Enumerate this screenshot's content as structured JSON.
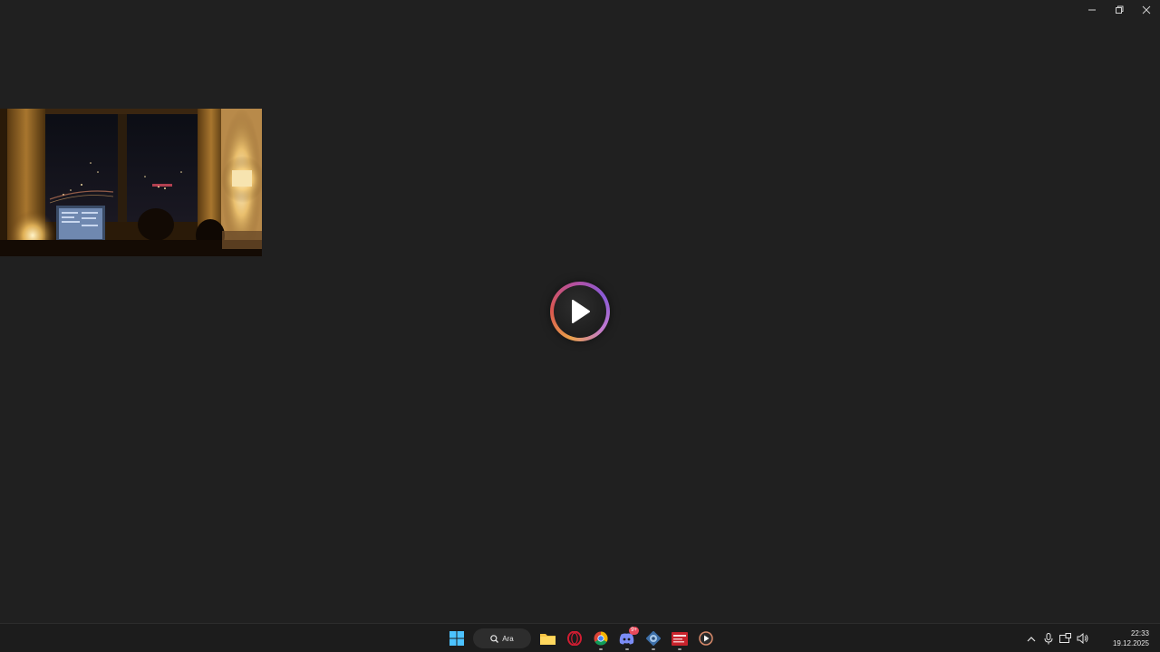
{
  "window": {
    "controls": [
      "minimize",
      "restore",
      "close"
    ]
  },
  "player": {
    "thumbnail_icon": "video-thumbnail",
    "play_icon": "play-icon",
    "accent_gradient": [
      "#e9a04a",
      "#d9574f",
      "#b8509b",
      "#8a5ad6"
    ]
  },
  "taskbar": {
    "search_label": "Ara",
    "apps": [
      {
        "name": "start",
        "icon": "windows-icon",
        "running": false
      },
      {
        "name": "file-explorer",
        "icon": "folder-icon",
        "running": false
      },
      {
        "name": "opera",
        "icon": "opera-icon",
        "running": false
      },
      {
        "name": "chrome",
        "icon": "chrome-icon",
        "running": true
      },
      {
        "name": "discord",
        "icon": "discord-icon",
        "running": true,
        "badge": "9+"
      },
      {
        "name": "app-blue",
        "icon": "gear-app-icon",
        "running": true
      },
      {
        "name": "app-red",
        "icon": "red-app-icon",
        "running": true
      },
      {
        "name": "media-player",
        "icon": "media-player-icon",
        "running": false
      }
    ],
    "tray": {
      "icons": [
        "chevron-up-icon",
        "microphone-icon",
        "network-icon",
        "volume-icon"
      ],
      "time": "22:33",
      "date": "19.12.2025"
    }
  }
}
